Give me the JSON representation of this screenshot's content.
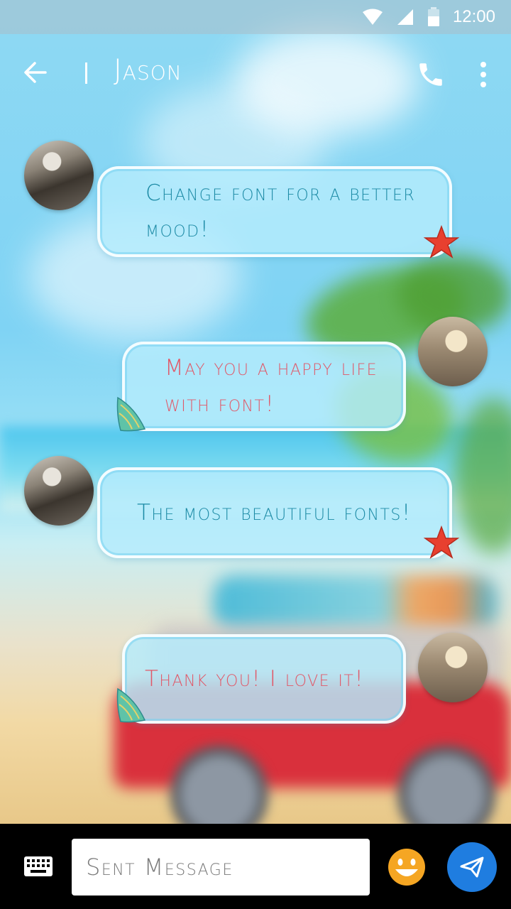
{
  "status_bar": {
    "time": "12:00"
  },
  "header": {
    "contact_name": "Jason"
  },
  "messages": [
    {
      "direction": "incoming",
      "text_lines": [
        "Change font for a better",
        "mood!"
      ]
    },
    {
      "direction": "outgoing",
      "text_lines": [
        "May you a happy life",
        "with font!"
      ]
    },
    {
      "direction": "incoming",
      "text_lines": [
        "The most beautiful fonts!"
      ]
    },
    {
      "direction": "outgoing",
      "text_lines": [
        "Thank you! I love it!"
      ]
    }
  ],
  "composer": {
    "placeholder": "Sent Message"
  },
  "icons": {
    "back": "arrow-left-icon",
    "call": "phone-icon",
    "more": "more-vert-icon",
    "keyboard": "keyboard-icon",
    "emoji": "smiley-icon",
    "send": "send-icon",
    "incoming_decoration": "starfish-icon",
    "outgoing_decoration": "seashell-icon"
  },
  "colors": {
    "incoming_text": "#1c8aa5",
    "outgoing_text": "#e15868",
    "send_button": "#1f7de0",
    "emoji": "#f5a623",
    "bottom_bar": "#000000"
  }
}
